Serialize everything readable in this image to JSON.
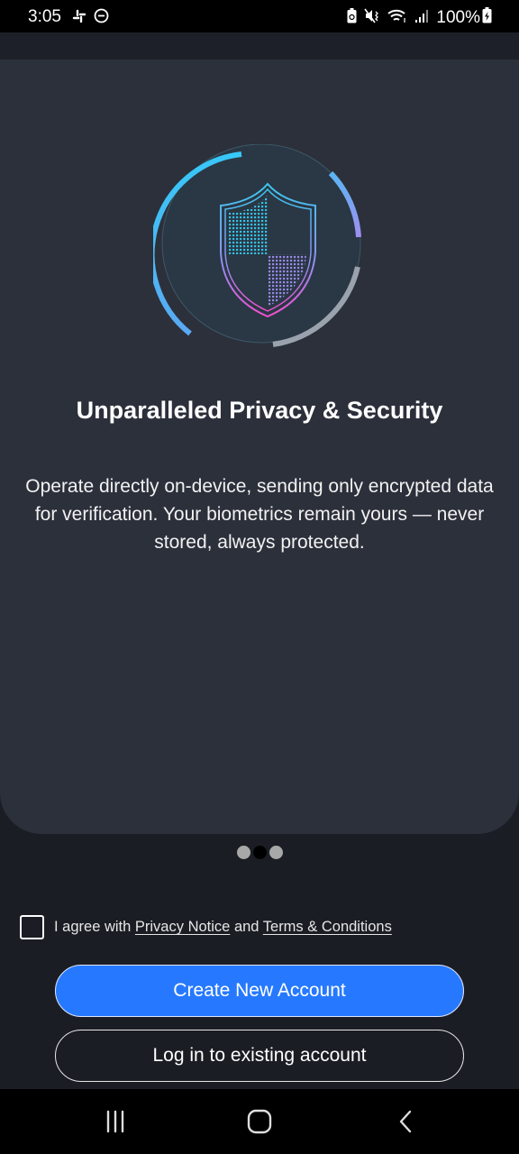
{
  "status_bar": {
    "time": "3:05",
    "left_icons": [
      "slack-icon",
      "do-not-disturb-icon"
    ],
    "right_icons": [
      "battery-saver-icon",
      "mute-vibrate-icon",
      "wifi-icon",
      "signal-icon"
    ],
    "battery": "100%",
    "battery_icon": "battery-charging-icon"
  },
  "onboarding": {
    "hero_icon": "shield-security-icon",
    "title": "Unparalleled Privacy & Security",
    "description": "Operate directly on-device, sending only encrypted data for verification. Your biometrics remain yours — never stored, always protected.",
    "pager": {
      "total": 3,
      "active_index": 1
    }
  },
  "agreement": {
    "checked": false,
    "prefix": "I agree with",
    "privacy_link": "Privacy Notice",
    "connector": "and",
    "terms_link": "Terms & Conditions"
  },
  "actions": {
    "primary_label": "Create New Account",
    "secondary_label": "Log in to existing account"
  },
  "colors": {
    "primary": "#2679ff",
    "card_bg": "#2c303b",
    "page_bg": "#1b1d24",
    "accent_cyan": "#3ccbf4",
    "accent_magenta": "#e455d6"
  },
  "nav_bar": {
    "items": [
      "recents-icon",
      "home-icon",
      "back-icon"
    ]
  }
}
